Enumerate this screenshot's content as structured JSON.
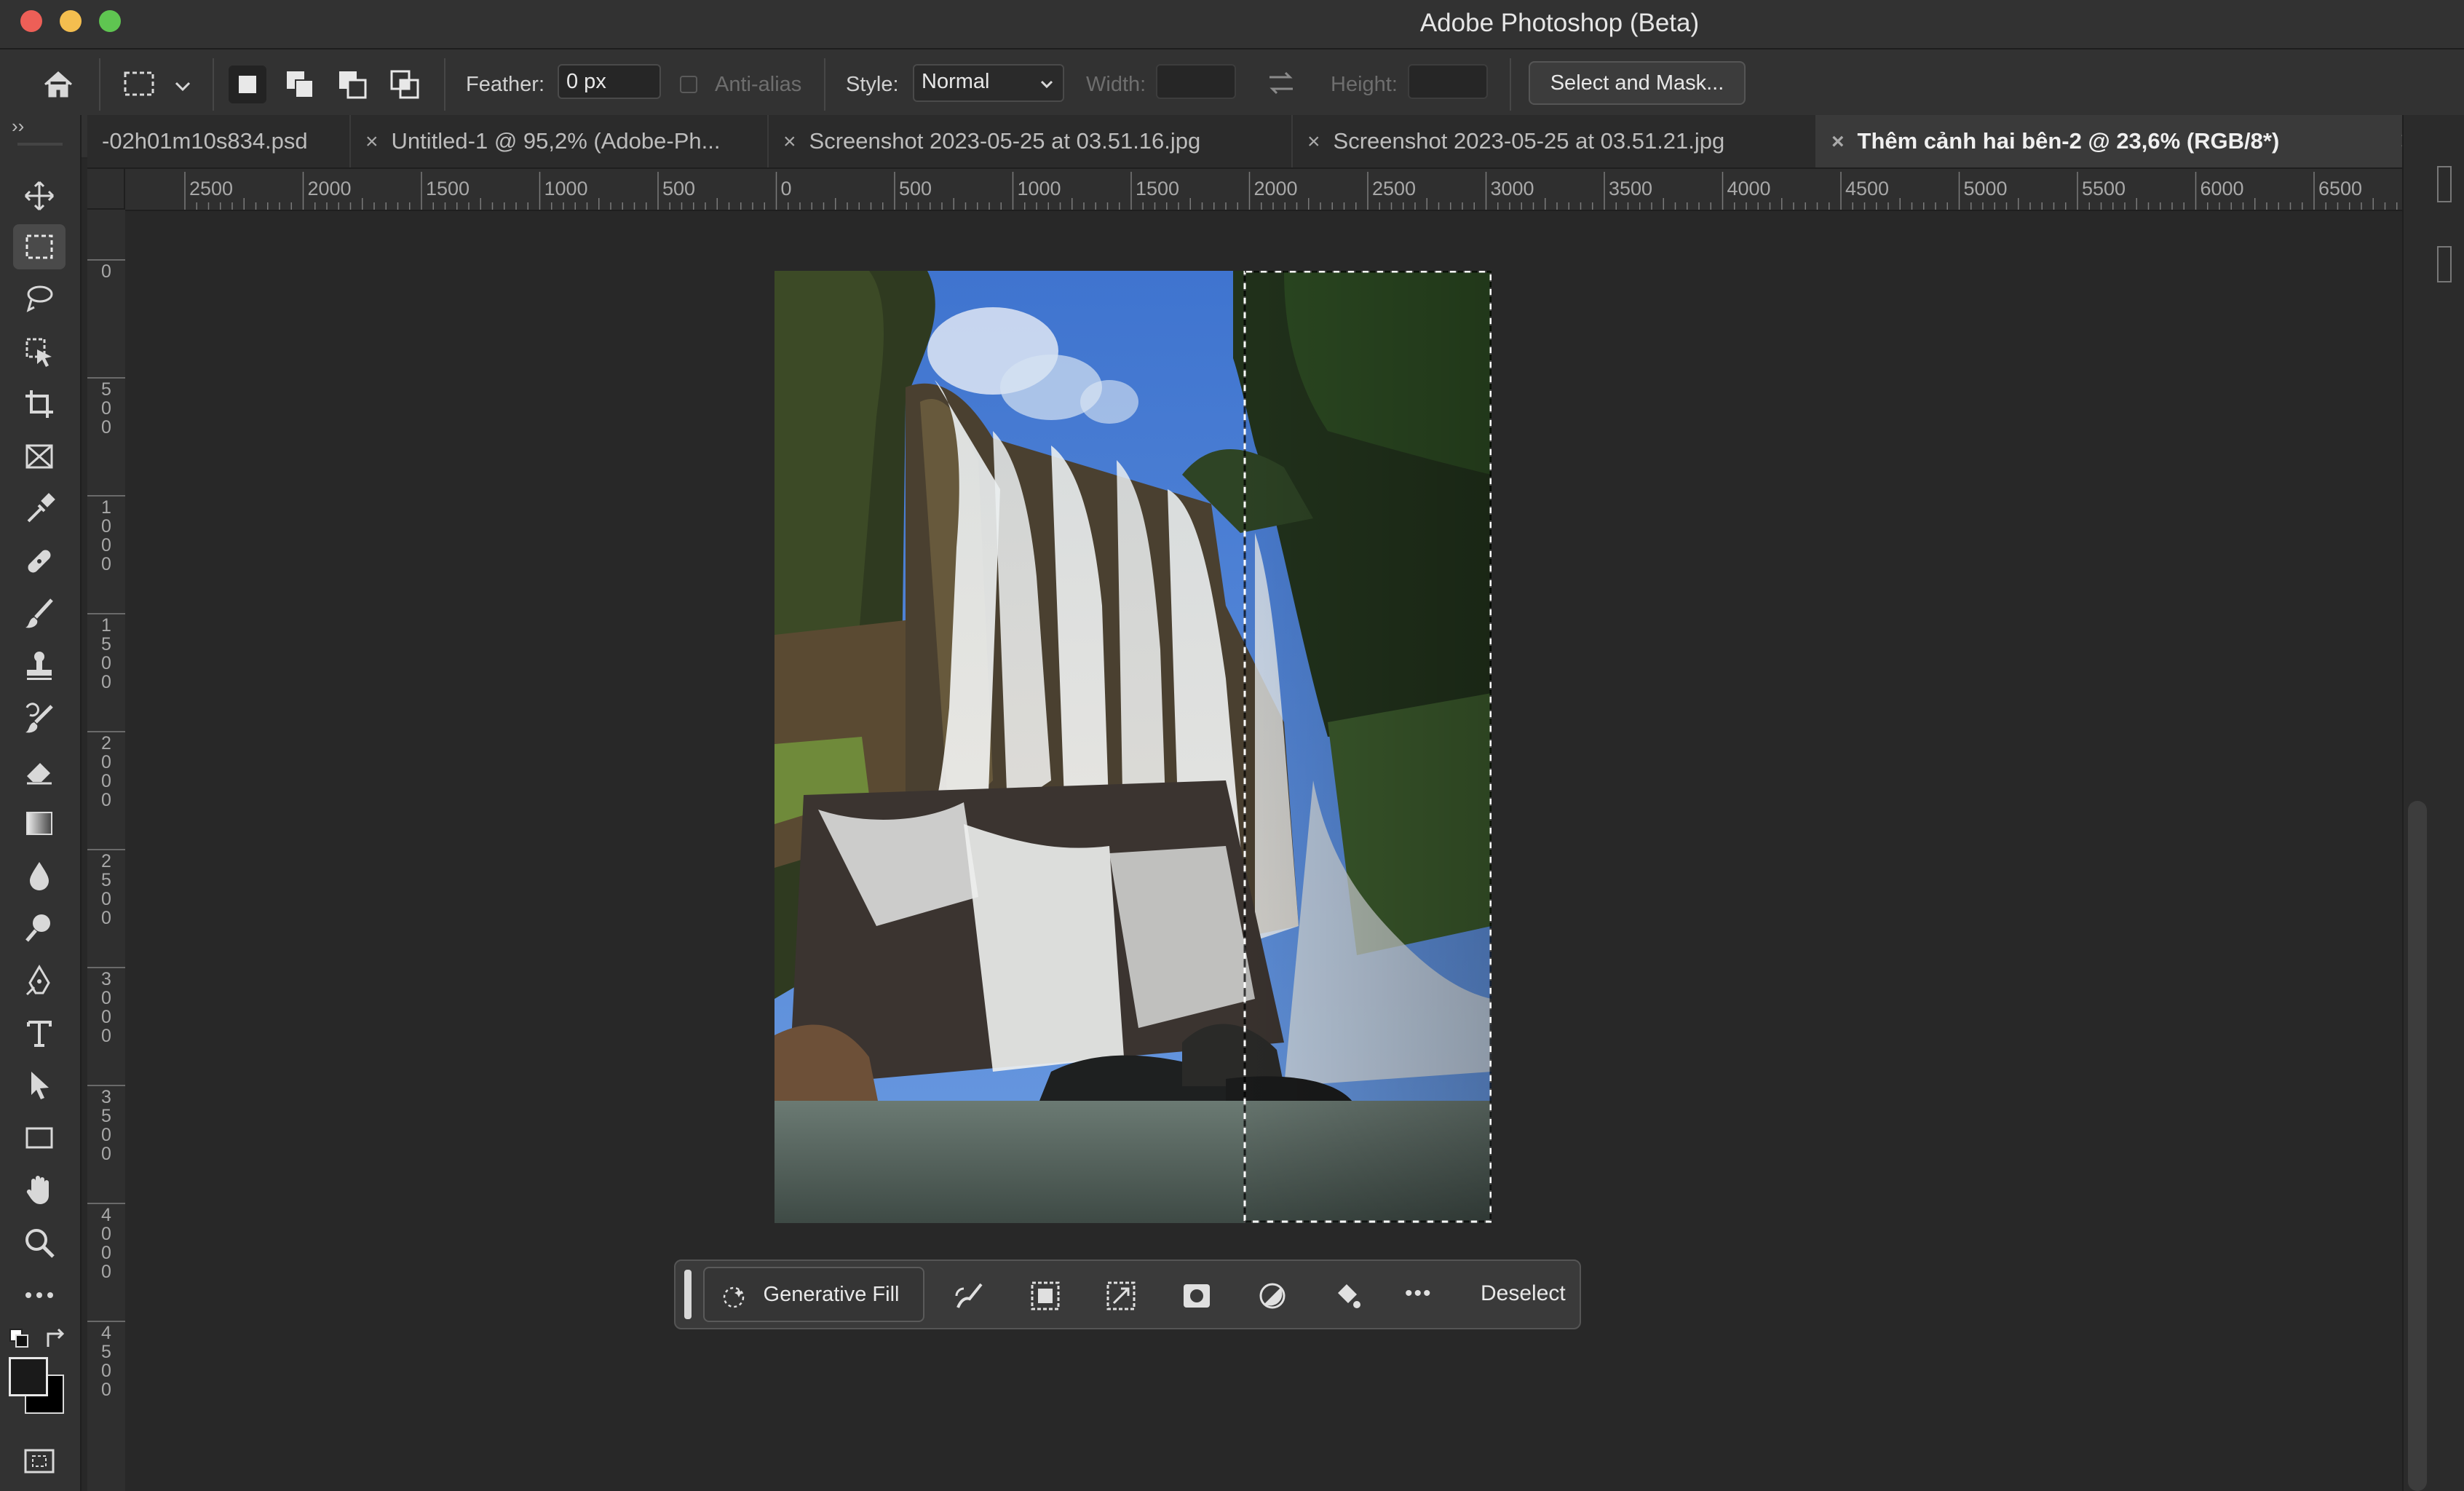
{
  "window": {
    "title": "Adobe Photoshop (Beta)"
  },
  "options_bar": {
    "feather_label": "Feather:",
    "feather_value": "0 px",
    "anti_alias_label": "Anti-alias",
    "style_label": "Style:",
    "style_value": "Normal",
    "width_label": "Width:",
    "height_label": "Height:",
    "select_mask_label": "Select and Mask..."
  },
  "tabs": [
    {
      "label": "-02h01m10s834.psd"
    },
    {
      "label": "Untitled-1 @ 95,2% (Adobe-Ph..."
    },
    {
      "label": "Screenshot 2023-05-25 at 03.51.16.jpg"
    },
    {
      "label": "Screenshot 2023-05-25 at 03.51.21.jpg"
    },
    {
      "label": "Thêm cảnh hai bên-2 @ 23,6% (RGB/8*)"
    }
  ],
  "tab_close": "×",
  "tabs_overflow": "»",
  "panel_toggle": "››",
  "ruler": {
    "h_ticks": [
      "2500",
      "2000",
      "1500",
      "1000",
      "500",
      "0",
      "500",
      "1000",
      "1500",
      "2000",
      "2500",
      "3000",
      "3500",
      "4000",
      "4500",
      "5000",
      "5500",
      "6000",
      "6500"
    ],
    "v_ticks": [
      "0",
      "500",
      "1000",
      "1500",
      "2000",
      "2500",
      "3000",
      "3500",
      "4000",
      "4500"
    ]
  },
  "context_bar": {
    "generative_fill_label": "Generative Fill",
    "deselect_label": "Deselect",
    "more_label": "•••"
  },
  "colors": {
    "ui_bg": "#323232",
    "canvas_bg": "#282828",
    "sky": "#4a7fd0"
  }
}
